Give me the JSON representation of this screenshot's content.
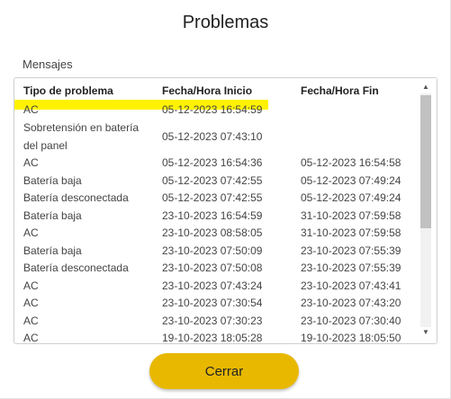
{
  "dialog": {
    "title": "Problemas",
    "section_label": "Mensajes",
    "close_label": "Cerrar"
  },
  "table": {
    "headers": [
      "Tipo de problema",
      "Fecha/Hora Inicio",
      "Fecha/Hora Fin"
    ],
    "rows": [
      [
        "AC",
        "05-12-2023 16:54:59",
        ""
      ],
      [
        "Sobretensión en batería del panel",
        "05-12-2023 07:43:10",
        ""
      ],
      [
        "AC",
        "05-12-2023 16:54:36",
        "05-12-2023 16:54:58"
      ],
      [
        "Batería baja",
        "05-12-2023 07:42:55",
        "05-12-2023 07:49:24"
      ],
      [
        "Batería desconectada",
        "05-12-2023 07:42:55",
        "05-12-2023 07:49:24"
      ],
      [
        "Batería baja",
        "23-10-2023 16:54:59",
        "31-10-2023 07:59:58"
      ],
      [
        "AC",
        "23-10-2023 08:58:05",
        "31-10-2023 07:59:58"
      ],
      [
        "Batería baja",
        "23-10-2023 07:50:09",
        "23-10-2023 07:55:39"
      ],
      [
        "Batería desconectada",
        "23-10-2023 07:50:08",
        "23-10-2023 07:55:39"
      ],
      [
        "AC",
        "23-10-2023 07:43:24",
        "23-10-2023 07:43:41"
      ],
      [
        "AC",
        "23-10-2023 07:30:54",
        "23-10-2023 07:43:20"
      ],
      [
        "AC",
        "23-10-2023 07:30:23",
        "23-10-2023 07:30:40"
      ],
      [
        "AC",
        "19-10-2023 18:05:28",
        "19-10-2023 18:05:50"
      ]
    ]
  },
  "colors": {
    "accent": "#e8b800",
    "highlight": "#fff200"
  },
  "icons": {
    "scroll_up": "triangle-up",
    "scroll_down": "triangle-down"
  }
}
